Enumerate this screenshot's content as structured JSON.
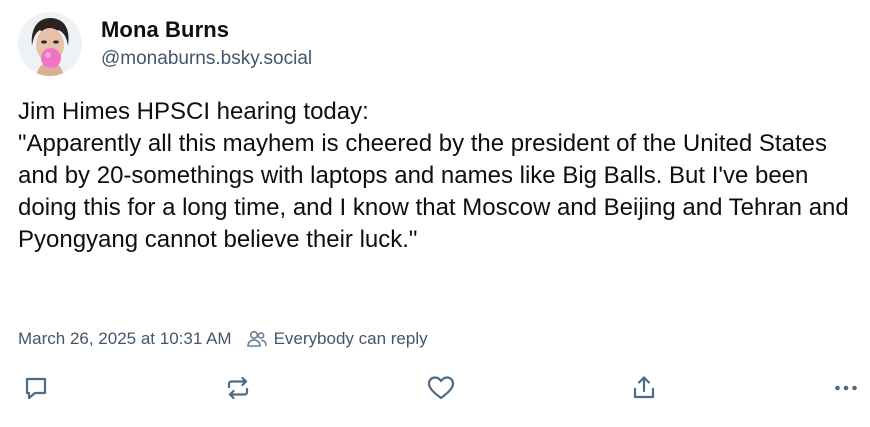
{
  "author": {
    "display_name": "Mona Burns",
    "handle": "@monaburns.bsky.social"
  },
  "post": {
    "text": "Jim Himes HPSCI hearing today:\n\"Apparently all this mayhem is cheered by the president of the United States and by 20-somethings with laptops and names like Big Balls. But I've been doing this for a long time, and I know that Moscow and Beijing and Tehran and Pyongyang cannot believe their luck.\"",
    "timestamp": "March 26, 2025 at 10:31 AM",
    "reply_setting": "Everybody can reply"
  },
  "actions": {
    "icons": [
      "reply-icon",
      "repost-icon",
      "like-icon",
      "share-icon",
      "more-icon"
    ]
  },
  "colors": {
    "text": "#0b0f14",
    "muted": "#42576c",
    "icon": "#4d6a86",
    "bubblegum": "#f173c6"
  }
}
